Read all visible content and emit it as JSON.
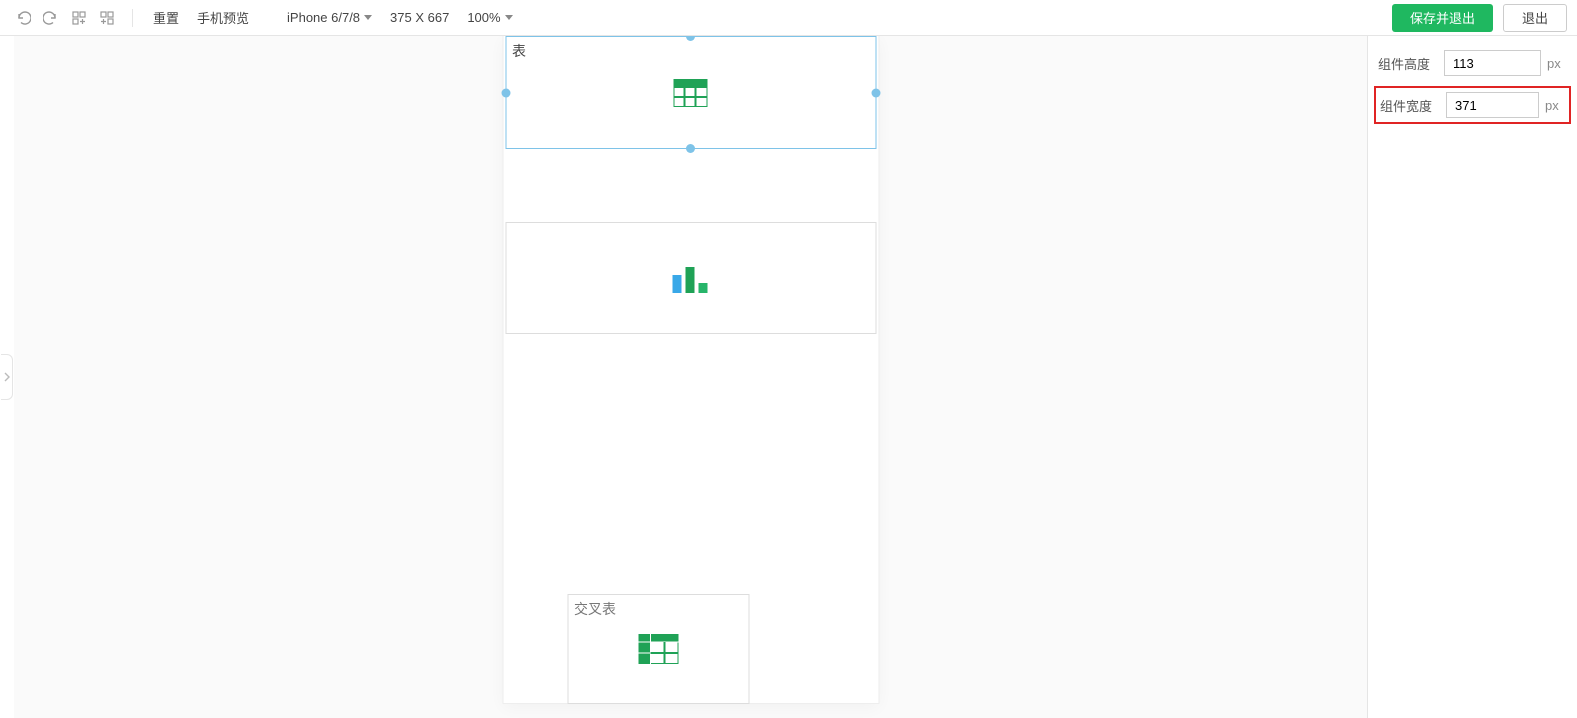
{
  "toolbar": {
    "reset": "重置",
    "preview": "手机预览",
    "device": "iPhone 6/7/8",
    "dims": "375 X 667",
    "zoom": "100%",
    "save_exit": "保存并退出",
    "exit": "退出"
  },
  "widgets": {
    "table": {
      "title": "表"
    },
    "cross_table": {
      "title": "交叉表"
    }
  },
  "props": {
    "height": {
      "label": "组件高度",
      "value": "113",
      "unit": "px"
    },
    "width": {
      "label": "组件宽度",
      "value": "371",
      "unit": "px"
    }
  }
}
